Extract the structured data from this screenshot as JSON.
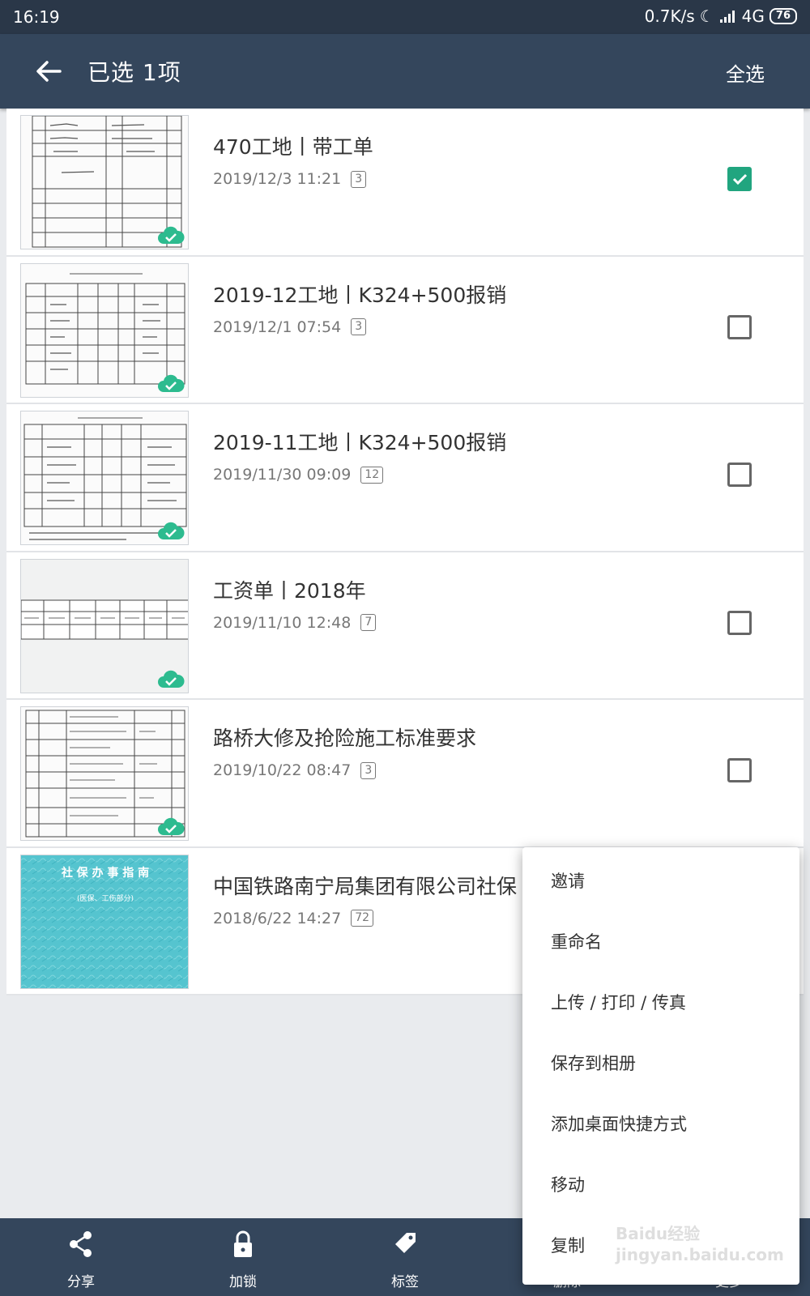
{
  "status_bar": {
    "time": "16:19",
    "network_speed": "0.7K/s",
    "network_type": "4G",
    "battery": "76"
  },
  "app_bar": {
    "title": "已选 1项",
    "select_all": "全选"
  },
  "documents": [
    {
      "title": "470工地丨带工单",
      "date": "2019/12/3 11:21",
      "pages": "3",
      "checked": true
    },
    {
      "title": "2019-12工地丨K324+500报销",
      "date": "2019/12/1 07:54",
      "pages": "3",
      "checked": false
    },
    {
      "title": "2019-11工地丨K324+500报销",
      "date": "2019/11/30 09:09",
      "pages": "12",
      "checked": false
    },
    {
      "title": "工资单丨2018年",
      "date": "2019/11/10 12:48",
      "pages": "7",
      "checked": false
    },
    {
      "title": "路桥大修及抢险施工标准要求",
      "date": "2019/10/22 08:47",
      "pages": "3",
      "checked": false
    },
    {
      "title": "中国铁路南宁局集团有限公司社保",
      "date": "2018/6/22 14:27",
      "pages": "72",
      "checked": false,
      "thumb_text": [
        "社 保 办 事 指 南",
        "(医保、工伤部分)"
      ]
    }
  ],
  "context_menu": [
    "邀请",
    "重命名",
    "上传 / 打印 / 传真",
    "保存到相册",
    "添加桌面快捷方式",
    "移动",
    "复制"
  ],
  "bottom_bar": [
    "分享",
    "加锁",
    "标签",
    "删除",
    "更多"
  ],
  "watermark": "Baidu经验 jingyan.baidu.com",
  "colors": {
    "status_bar": "#2a3748",
    "app_bar": "#34465c",
    "accent_green": "#21a57f",
    "cloud_green": "#2dbb8f"
  }
}
